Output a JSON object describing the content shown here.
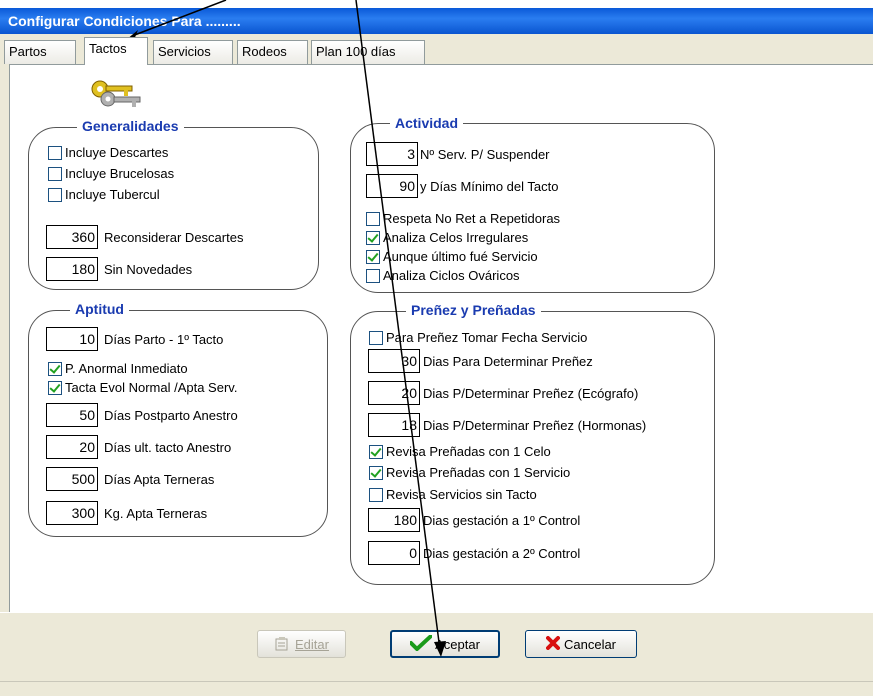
{
  "window": {
    "title": "Configurar Condiciones Para ........."
  },
  "tabs": [
    {
      "label": "Partos"
    },
    {
      "label": "Tactos"
    },
    {
      "label": "Servicios"
    },
    {
      "label": "Rodeos"
    },
    {
      "label": "Plan 100 días"
    }
  ],
  "generalidades": {
    "title": "Generalidades",
    "icon": "keys-icon",
    "checks": [
      {
        "label": "Incluye Descartes",
        "checked": false
      },
      {
        "label": "Incluye Brucelosas",
        "checked": false
      },
      {
        "label": "Incluye Tubercul",
        "checked": false
      }
    ],
    "fields": [
      {
        "value": "360",
        "label": "Reconsiderar Descartes"
      },
      {
        "value": "180",
        "label": "Sin Novedades"
      }
    ]
  },
  "aptitud": {
    "title": "Aptitud",
    "dias_parto": {
      "value": "10",
      "label": "Días Parto - 1º Tacto"
    },
    "checks": [
      {
        "label": "P. Anormal Inmediato",
        "checked": true
      },
      {
        "label": "Tacta Evol Normal /Apta Serv.",
        "checked": true
      }
    ],
    "fields": [
      {
        "value": "50",
        "label": "Días Postparto Anestro"
      },
      {
        "value": "20",
        "label": "Días ult. tacto Anestro"
      },
      {
        "value": "500",
        "label": "Días Apta Terneras"
      },
      {
        "value": "300",
        "label": "Kg. Apta Terneras"
      }
    ]
  },
  "actividad": {
    "title": "Actividad",
    "fields": [
      {
        "value": "3",
        "label": "Nº Serv. P/ Suspender"
      },
      {
        "value": "90",
        "label": "y Días Mínimo del Tacto"
      }
    ],
    "checks": [
      {
        "label": "Respeta No Ret a Repetidoras",
        "checked": false
      },
      {
        "label": "Analiza Celos Irregulares",
        "checked": true
      },
      {
        "label": "Aunque último fué Servicio",
        "checked": true
      },
      {
        "label": "Analiza Ciclos Ováricos",
        "checked": false
      }
    ]
  },
  "prenez": {
    "title": "Preñez y Preñadas",
    "check_fecha": {
      "label": "Para Preñez Tomar Fecha Servicio",
      "checked": false
    },
    "fields": [
      {
        "value": "30",
        "label": "Dias Para Determinar Preñez"
      },
      {
        "value": "20",
        "label": "Dias P/Determinar Preñez (Ecógrafo)"
      },
      {
        "value": "18",
        "label": "Dias P/Determinar Preñez (Hormonas)"
      }
    ],
    "checks": [
      {
        "label": "Revisa Preñadas con 1 Celo",
        "checked": true
      },
      {
        "label": "Revisa Preñadas con 1 Servicio",
        "checked": true
      },
      {
        "label": "Revisa Servicios sin Tacto",
        "checked": false
      }
    ],
    "control_fields": [
      {
        "value": "180",
        "label": "Dias gestación a 1º Control"
      },
      {
        "value": "0",
        "label": "Dias gestación a 2º Control"
      }
    ]
  },
  "buttons": {
    "editar": "Editar",
    "aceptar": "Aceptar",
    "cancelar": "Cancelar"
  }
}
